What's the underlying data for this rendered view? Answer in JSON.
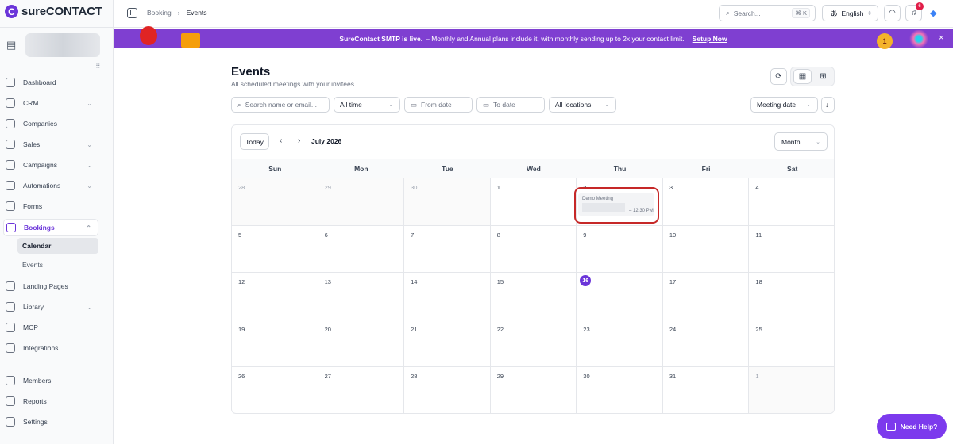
{
  "app": {
    "logo_mark": "C",
    "logo_text": "sureCONTACT"
  },
  "topbar": {
    "breadcrumb": [
      "Booking",
      "Events"
    ],
    "separator": "›",
    "search_placeholder": "Search...",
    "search_shortcut": "⌘ K",
    "language": "English",
    "notification_count": "6"
  },
  "banner": {
    "lead": "SureContact SMTP is live.",
    "text": " – Monthly and Annual plans include it, with monthly sending up to 2x your contact limit.",
    "link": "Setup Now",
    "medal": "1"
  },
  "sidebar": {
    "items": [
      {
        "label": "Dashboard",
        "icon": "dashboard-icon",
        "chevron": false
      },
      {
        "label": "CRM",
        "icon": "crm-icon",
        "chevron": true
      },
      {
        "label": "Companies",
        "icon": "building-icon",
        "chevron": false
      },
      {
        "label": "Sales",
        "icon": "sales-icon",
        "chevron": true
      },
      {
        "label": "Campaigns",
        "icon": "megaphone-icon",
        "chevron": true
      },
      {
        "label": "Automations",
        "icon": "automation-icon",
        "chevron": true
      },
      {
        "label": "Forms",
        "icon": "form-icon",
        "chevron": false
      },
      {
        "label": "Bookings",
        "icon": "calendar-icon",
        "chevron": true,
        "active": true
      },
      {
        "label": "Landing Pages",
        "icon": "layout-icon",
        "chevron": false
      },
      {
        "label": "Library",
        "icon": "library-icon",
        "chevron": true
      },
      {
        "label": "MCP",
        "icon": "mcp-icon",
        "chevron": false
      },
      {
        "label": "Integrations",
        "icon": "integrations-icon",
        "chevron": false
      },
      {
        "label": "Members",
        "icon": "members-icon",
        "chevron": false
      },
      {
        "label": "Reports",
        "icon": "reports-icon",
        "chevron": false
      },
      {
        "label": "Settings",
        "icon": "settings-icon",
        "chevron": false
      }
    ],
    "sub_items": [
      {
        "label": "Calendar",
        "current": true
      },
      {
        "label": "Events",
        "current": false
      }
    ]
  },
  "page": {
    "title": "Events",
    "subtitle": "All scheduled meetings with your invitees"
  },
  "filters": {
    "search_placeholder": "Search name or email...",
    "time": "All time",
    "from_date": "From date",
    "to_date": "To date",
    "locations": "All locations",
    "sort": "Meeting date"
  },
  "calendar": {
    "today_label": "Today",
    "month_label": "July 2026",
    "view_select": "Month",
    "weekdays": [
      "Sun",
      "Mon",
      "Tue",
      "Wed",
      "Thu",
      "Fri",
      "Sat"
    ],
    "weeks": [
      [
        "28",
        "29",
        "30",
        "1",
        "2",
        "3",
        "4"
      ],
      [
        "5",
        "6",
        "7",
        "8",
        "9",
        "10",
        "11"
      ],
      [
        "12",
        "13",
        "14",
        "15",
        "16",
        "17",
        "18"
      ],
      [
        "19",
        "20",
        "21",
        "22",
        "23",
        "24",
        "25"
      ],
      [
        "26",
        "27",
        "28",
        "29",
        "30",
        "31",
        "1"
      ]
    ],
    "today": "16",
    "event": {
      "name": "Demo Meeting",
      "time": "– 12:30 PM"
    }
  },
  "help": {
    "label": "Need Help?"
  }
}
